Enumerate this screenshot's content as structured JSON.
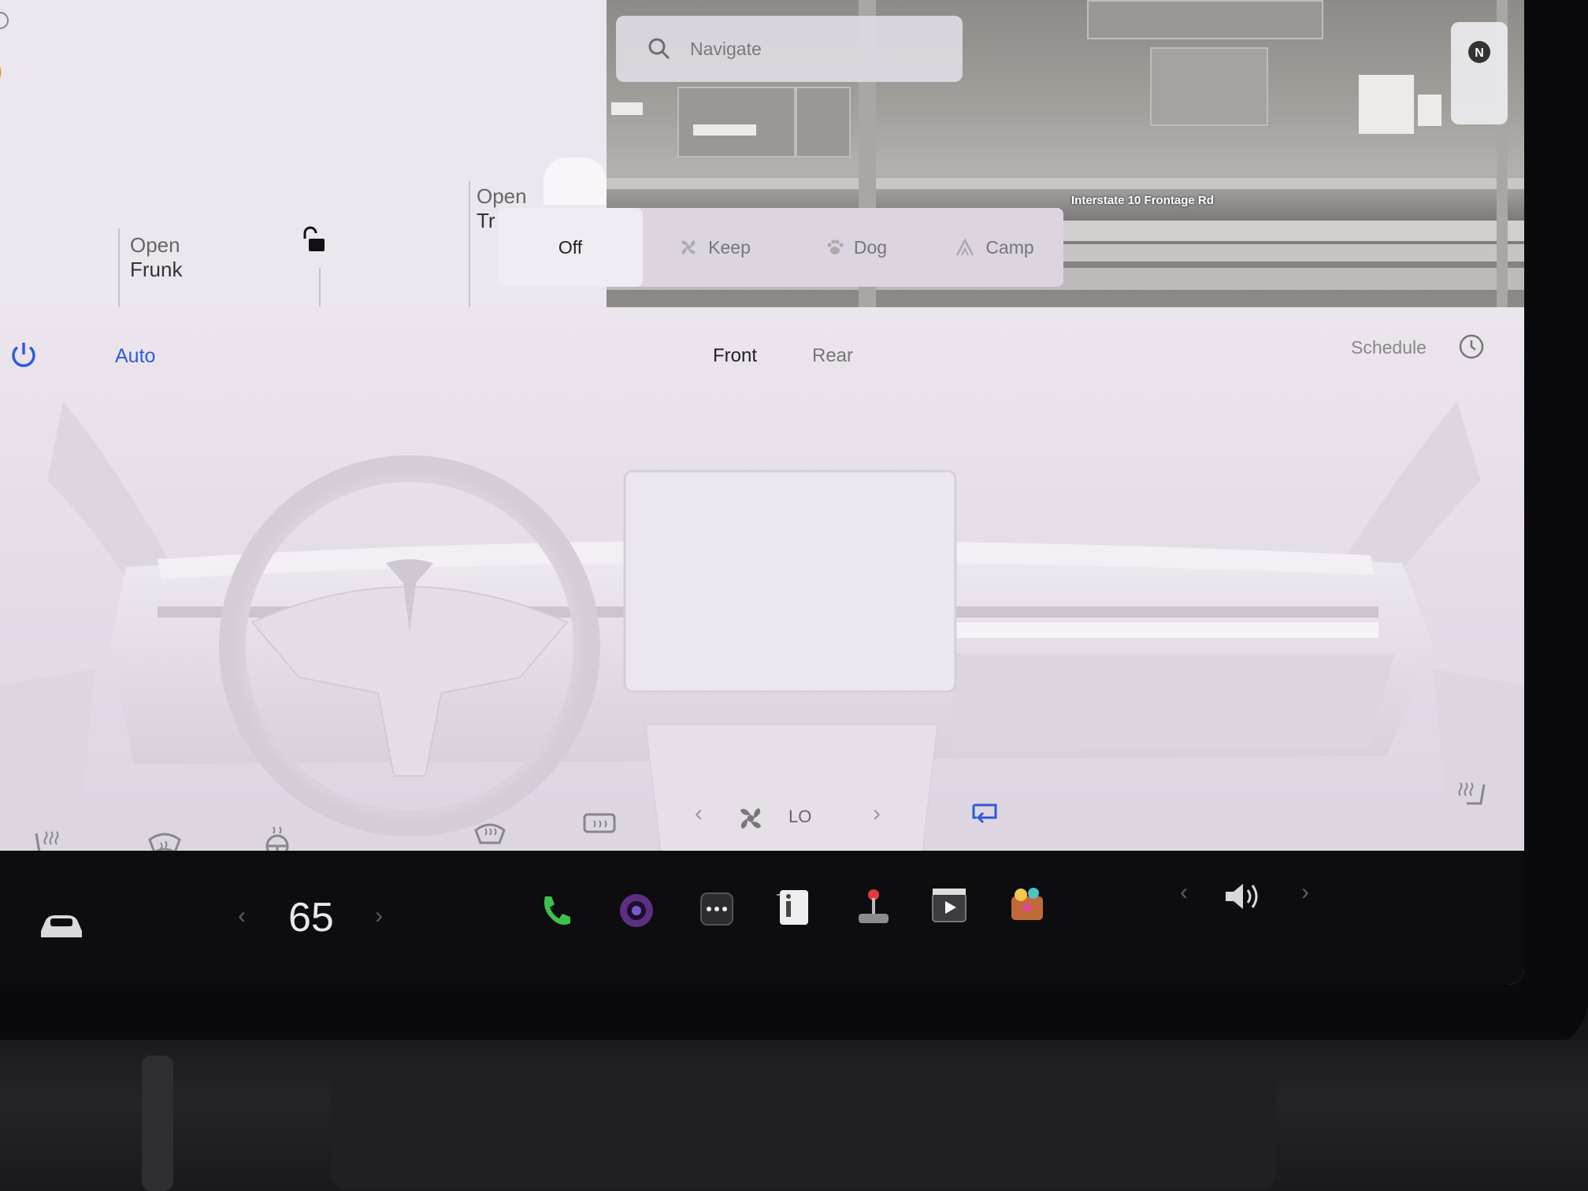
{
  "car_panel": {
    "frunk": {
      "line1": "Open",
      "line2": "Frunk"
    },
    "trunk": {
      "line1": "Open",
      "line2": "Tr"
    }
  },
  "map": {
    "search_placeholder": "Navigate",
    "road_label": "Interstate 10 Frontage Rd"
  },
  "modes": [
    {
      "label": "Off",
      "icon": "power-off",
      "active": true
    },
    {
      "label": "Keep",
      "icon": "fan-icon",
      "active": false
    },
    {
      "label": "Dog",
      "icon": "paw-icon",
      "active": false
    },
    {
      "label": "Camp",
      "icon": "tent-icon",
      "active": false
    }
  ],
  "climate": {
    "auto_label": "Auto",
    "front_label": "Front",
    "rear_label": "Rear",
    "schedule_label": "Schedule",
    "fan_value": "LO",
    "accent_color": "#2f5bd9"
  },
  "taskbar": {
    "temperature": "65",
    "apps": [
      "phone",
      "camera",
      "more",
      "manual",
      "arcade",
      "theater",
      "toybox"
    ]
  }
}
